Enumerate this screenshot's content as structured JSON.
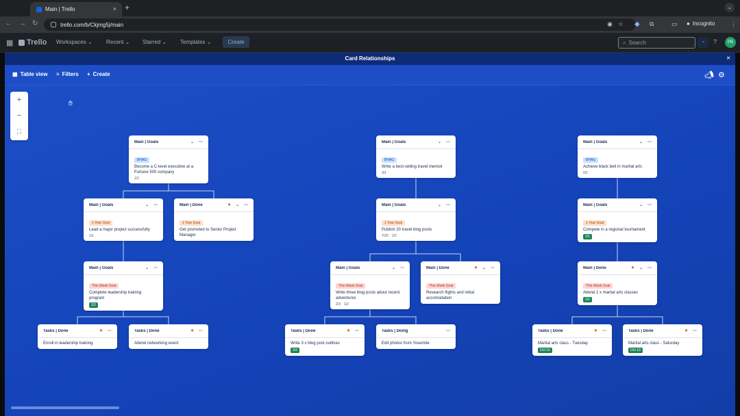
{
  "browser": {
    "tab_title": "Main | Trello",
    "new_tab": "+",
    "close": "×",
    "url": "trello.com/b/Ckjmg5j/main",
    "incognito": "Incognito"
  },
  "trello": {
    "logo": "Trello",
    "nav": [
      "Workspaces",
      "Recent",
      "Starred",
      "Templates"
    ],
    "create": "Create",
    "search_placeholder": "Search",
    "avatar_initials": "PB"
  },
  "modal": {
    "title": "Card Relationships",
    "close": "×",
    "toolbar": {
      "table_view": "Table view",
      "filters": "Filters",
      "create": "Create"
    }
  },
  "zoom": {
    "in": "+",
    "out": "−",
    "fit": "⛶"
  },
  "colors": {
    "board_bg": "#1443b8",
    "done_badge": "#1f845a"
  },
  "cards": [
    {
      "list": "Main | Goals",
      "label": "BHAG",
      "label_color": "blue",
      "title": "Become a C-level executive at a Fortune 500 company",
      "meta": [
        "1/2"
      ]
    },
    {
      "list": "Main | Goals",
      "label": "1 Year Goal",
      "label_color": "orange",
      "title": "Lead a major project successfully",
      "meta": [
        "1/1"
      ]
    },
    {
      "list": "Main | Done",
      "done": true,
      "label": "1 Year Goal",
      "label_color": "orange",
      "title": "Get promoted to Senior Project Manager"
    },
    {
      "list": "Main | Goals",
      "label": "This Week Goal",
      "label_color": "red",
      "title": "Complete leadership training program",
      "green": "2/2"
    },
    {
      "list": "Tasks | Done",
      "done": true,
      "title": "Enroll in leadership training"
    },
    {
      "list": "Tasks | Done",
      "done": true,
      "title": "Attend networking event"
    },
    {
      "list": "Main | Goals",
      "label": "BHAG",
      "label_color": "blue",
      "title": "Write a best-selling travel memoir",
      "meta": [
        "3/1"
      ]
    },
    {
      "list": "Main | Goals",
      "label": "1 Year Goal",
      "label_color": "orange",
      "title": "Publish 20 travel blog posts",
      "meta": [
        "7/20",
        "1/2"
      ]
    },
    {
      "list": "Main | Goals",
      "label": "This Week Goal",
      "label_color": "red",
      "title": "Write three blog posts about recent adventures",
      "meta": [
        "2/3",
        "1/2"
      ]
    },
    {
      "list": "Main | Done",
      "done": true,
      "label": "This Week Goal",
      "label_color": "red",
      "title": "Research flights and initial accomodation"
    },
    {
      "list": "Tasks | Done",
      "done": true,
      "title": "Write 3 x blog post outlines",
      "green": "3/3"
    },
    {
      "list": "Tasks | Doing",
      "title": "Edit photos from Yosemite"
    },
    {
      "list": "Main | Goals",
      "label": "BHAG",
      "label_color": "blue",
      "title": "Achieve black belt in martial arts",
      "meta": [
        "0/1"
      ]
    },
    {
      "list": "Main | Goals",
      "label": "1 Year Goal",
      "label_color": "orange",
      "title": "Compete in a regional tournament",
      "green": "1/1"
    },
    {
      "list": "Main | Done",
      "done": true,
      "label": "This Week Goal",
      "label_color": "red",
      "title": "Attend 2 x martial arts classes",
      "green": "2/2"
    },
    {
      "list": "Tasks | Done",
      "done": true,
      "title": "Martial arts class - Tuesday",
      "green": "Oct 15"
    },
    {
      "list": "Tasks | Done",
      "done": true,
      "title": "Martial arts class - Saturday",
      "green": "Oct 19"
    }
  ]
}
